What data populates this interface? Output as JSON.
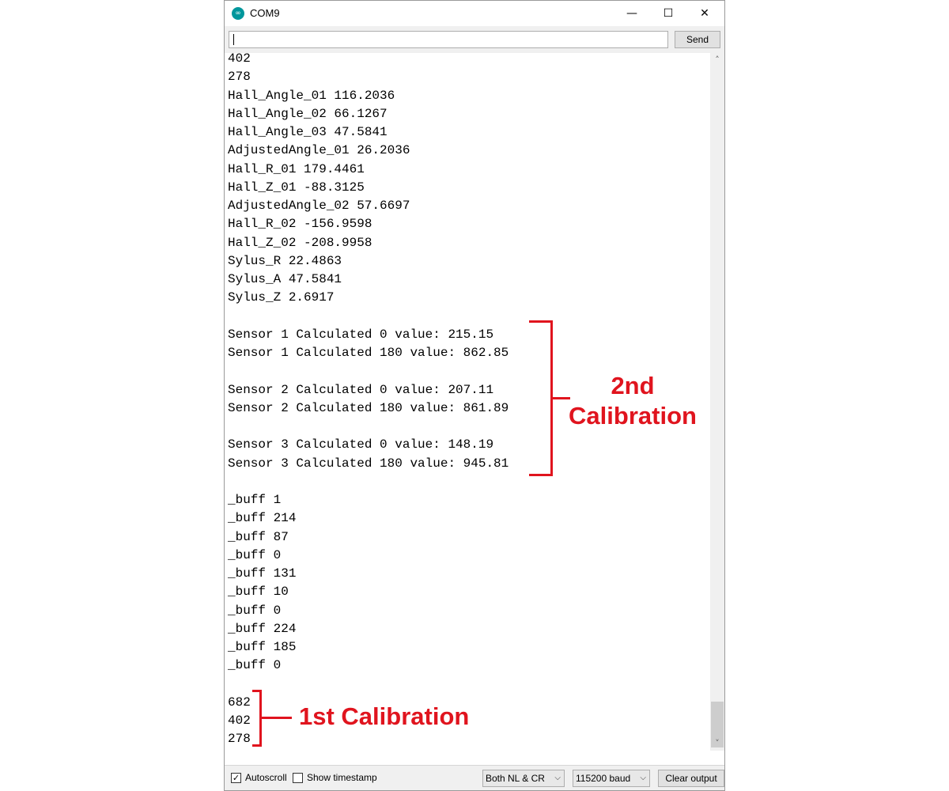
{
  "window": {
    "title": "COM9",
    "app_icon_glyph": "∞",
    "minimize_glyph": "—",
    "maximize_glyph": "☐",
    "close_glyph": "✕"
  },
  "toolbar": {
    "input_value": "",
    "send_label": "Send"
  },
  "output": {
    "lines": [
      "402",
      "278",
      "Hall_Angle_01 116.2036",
      "Hall_Angle_02 66.1267",
      "Hall_Angle_03 47.5841",
      "AdjustedAngle_01 26.2036",
      "Hall_R_01 179.4461",
      "Hall_Z_01 -88.3125",
      "AdjustedAngle_02 57.6697",
      "Hall_R_02 -156.9598",
      "Hall_Z_02 -208.9958",
      "Sylus_R 22.4863",
      "Sylus_A 47.5841",
      "Sylus_Z 2.6917",
      "",
      "Sensor 1 Calculated 0 value: 215.15",
      "Sensor 1 Calculated 180 value: 862.85",
      "",
      "Sensor 2 Calculated 0 value: 207.11",
      "Sensor 2 Calculated 180 value: 861.89",
      "",
      "Sensor 3 Calculated 0 value: 148.19",
      "Sensor 3 Calculated 180 value: 945.81",
      "",
      "_buff 1",
      "_buff 214",
      "_buff 87",
      "_buff 0",
      "_buff 131",
      "_buff 10",
      "_buff 0",
      "_buff 224",
      "_buff 185",
      "_buff 0",
      "",
      "682",
      "402",
      "278"
    ]
  },
  "bottom_bar": {
    "autoscroll_label": "Autoscroll",
    "autoscroll_checked": true,
    "autoscroll_mark": "✓",
    "show_timestamp_label": "Show timestamp",
    "show_timestamp_checked": false,
    "line_ending_value": "Both NL & CR",
    "baud_value": "115200 baud",
    "dropdown_glyph": "⌵",
    "clear_output_label": "Clear output"
  },
  "annotations": {
    "second_calibration_line1": "2nd",
    "second_calibration_line2": "Calibration",
    "first_calibration": "1st Calibration",
    "color": "#e0141e"
  },
  "colors": {
    "arduino_teal": "#00979c",
    "annotation_red": "#e0141e"
  },
  "scrollbar": {
    "up_glyph": "˄",
    "down_glyph": "˅"
  }
}
